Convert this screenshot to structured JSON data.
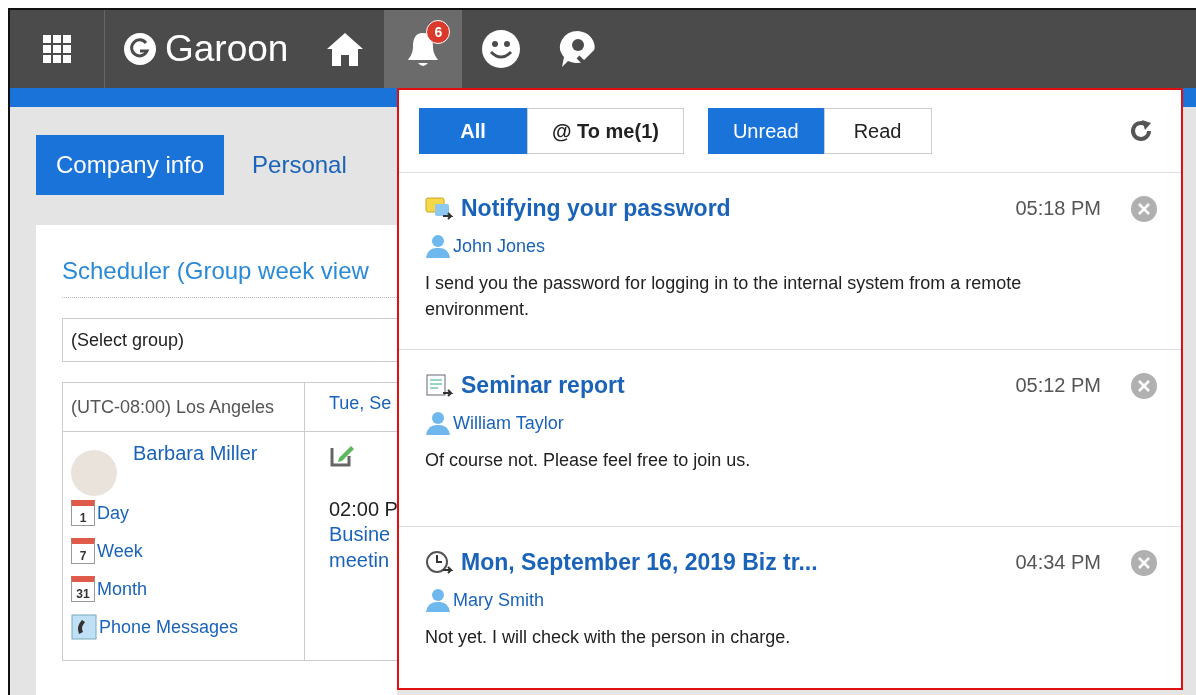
{
  "topbar": {
    "logo": "Garoon",
    "notification_count": "6"
  },
  "tabs": [
    {
      "label": "Company info",
      "selected": true
    },
    {
      "label": "Personal",
      "selected": false
    }
  ],
  "scheduler": {
    "title": "Scheduler (Group week view",
    "group_select": "(Select group)",
    "timezone": "(UTC-08:00) Los Angeles",
    "date_header": "Tue, Se",
    "user": "Barbara Miller",
    "links": [
      {
        "kind": "day",
        "icon_text": "1",
        "label": "Day"
      },
      {
        "kind": "week",
        "icon_text": "7",
        "label": "Week"
      },
      {
        "kind": "month",
        "icon_text": "31",
        "label": "Month"
      },
      {
        "kind": "phone",
        "label": "Phone Messages"
      }
    ],
    "event_time": "02:00 P",
    "event_title": [
      "Busine",
      "meetin"
    ]
  },
  "notifications": {
    "scope_filters": [
      {
        "label": "All",
        "selected": true
      },
      {
        "label": "@ To me(1)",
        "selected": false
      }
    ],
    "read_filters": [
      {
        "label": "Unread",
        "selected": true
      },
      {
        "label": "Read",
        "selected": false
      }
    ],
    "items": [
      {
        "kind": "message",
        "title": "Notifying your password",
        "time": "05:18 PM",
        "sender": "John Jones",
        "body": "I send you the password for logging in to the internal system from a remote environment."
      },
      {
        "kind": "report",
        "title": "Seminar report",
        "time": "05:12 PM",
        "sender": "William Taylor",
        "body": "Of course not. Please feel free to join us."
      },
      {
        "kind": "schedule",
        "title": "Mon, September 16, 2019 Biz tr...",
        "time": "04:34 PM",
        "sender": "Mary Smith",
        "body": "Not yet. I will check with the person in charge."
      }
    ]
  }
}
